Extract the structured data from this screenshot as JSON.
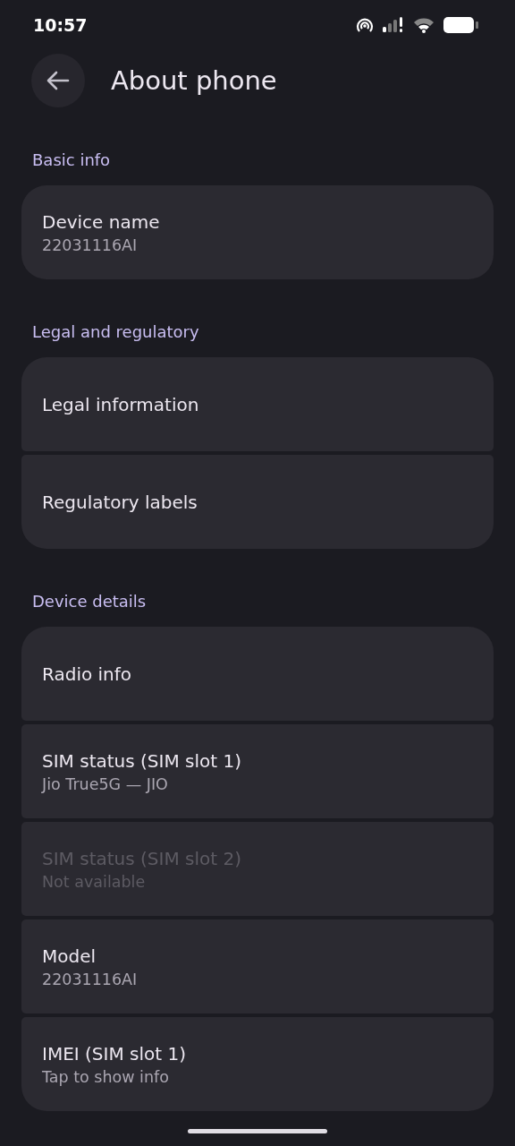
{
  "status_bar": {
    "time": "10:57"
  },
  "header": {
    "title": "About phone"
  },
  "sections": [
    {
      "title": "Basic info",
      "items": [
        {
          "title": "Device name",
          "summary": "22031116AI",
          "disabled": false
        }
      ]
    },
    {
      "title": "Legal and regulatory",
      "items": [
        {
          "title": "Legal information",
          "disabled": false
        },
        {
          "title": "Regulatory labels",
          "disabled": false
        }
      ]
    },
    {
      "title": "Device details",
      "items": [
        {
          "title": "Radio info",
          "disabled": false
        },
        {
          "title": "SIM status (SIM slot 1)",
          "summary": "Jio True5G — JIO",
          "disabled": false
        },
        {
          "title": "SIM status (SIM slot 2)",
          "summary": "Not available",
          "disabled": true
        },
        {
          "title": "Model",
          "summary": "22031116AI",
          "disabled": false
        },
        {
          "title": "IMEI (SIM slot 1)",
          "summary": "Tap to show info",
          "disabled": false
        }
      ]
    }
  ]
}
